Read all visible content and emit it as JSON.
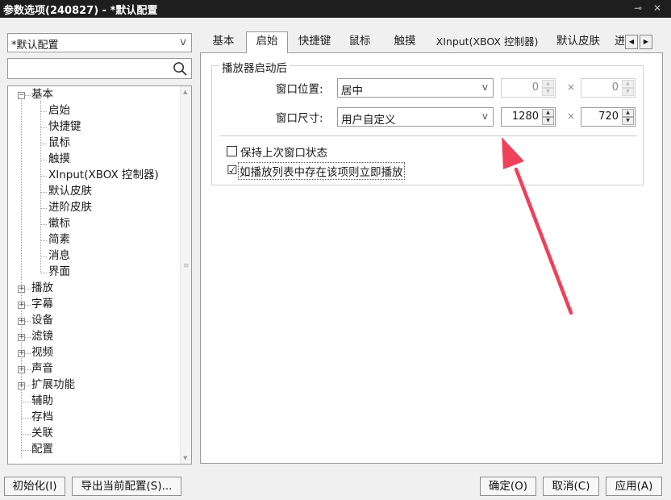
{
  "window": {
    "title": "参数选项(240827) - *默认配置",
    "pin_glyph": "⊸",
    "close_glyph": "✕"
  },
  "sidebar": {
    "profile_value": "*默认配置",
    "dropdown_arrow": "v",
    "search_placeholder": "",
    "tree": {
      "basic": {
        "label": "基本",
        "expander": "−",
        "children": [
          "启始",
          "快捷键",
          "鼠标",
          "触摸",
          "XInput(XBOX 控制器)",
          "默认皮肤",
          "进阶皮肤",
          "徽标",
          "简素",
          "消息",
          "界面"
        ]
      },
      "groups": [
        {
          "label": "播放",
          "expander": "+"
        },
        {
          "label": "字幕",
          "expander": "+"
        },
        {
          "label": "设备",
          "expander": "+"
        },
        {
          "label": "滤镜",
          "expander": "+"
        },
        {
          "label": "视频",
          "expander": "+"
        },
        {
          "label": "声音",
          "expander": "+"
        },
        {
          "label": "扩展功能",
          "expander": "+"
        }
      ],
      "leaves": [
        "辅助",
        "存档",
        "关联",
        "配置"
      ]
    }
  },
  "tabs": {
    "items": [
      "基本",
      "启始",
      "快捷键",
      "鼠标",
      "触摸",
      "XInput(XBOX 控制器)",
      "默认皮肤",
      "进"
    ],
    "active": "启始",
    "scroll_left": "◀",
    "scroll_right": "▶"
  },
  "startup": {
    "group_title": "播放器启动后",
    "position": {
      "label": "窗口位置:",
      "value": "居中",
      "x": "0",
      "y": "0"
    },
    "size": {
      "label": "窗口尺寸:",
      "value": "用户自定义",
      "width": "1280",
      "height": "720"
    },
    "times_glyph": "×",
    "spin_up": "▲",
    "spin_down": "▼",
    "checkboxes": [
      {
        "label": "保持上次窗口状态",
        "checked": false,
        "mark": ""
      },
      {
        "label": "如播放列表中存在该项则立即播放",
        "checked": true,
        "mark": "☑"
      }
    ]
  },
  "footer": {
    "reset": "初始化(I)",
    "export": "导出当前配置(S)...",
    "ok": "确定(O)",
    "cancel": "取消(C)",
    "apply": "应用(A)"
  },
  "colors": {
    "annotation_arrow": "#f0405a",
    "titlebar": "#1e1e1e"
  }
}
